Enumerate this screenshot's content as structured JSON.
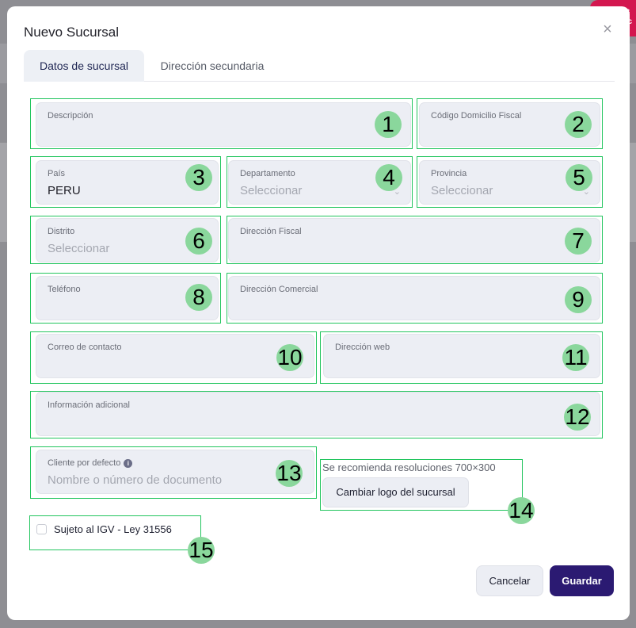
{
  "background": {
    "badge_text": "ic ac"
  },
  "modal": {
    "title": "Nuevo Sucursal",
    "close_symbol": "×"
  },
  "tabs": [
    {
      "label": "Datos de sucursal",
      "active": true
    },
    {
      "label": "Dirección secundaria",
      "active": false
    }
  ],
  "fields": {
    "descripcion": {
      "label": "Descripción",
      "value": ""
    },
    "codigo_domicilio": {
      "label": "Código Domicilio Fiscal",
      "value": ""
    },
    "pais": {
      "label": "País",
      "value": "PERU"
    },
    "departamento": {
      "label": "Departamento",
      "placeholder": "Seleccionar"
    },
    "provincia": {
      "label": "Provincia",
      "placeholder": "Seleccionar"
    },
    "distrito": {
      "label": "Distrito",
      "placeholder": "Seleccionar"
    },
    "direccion_fiscal": {
      "label": "Dirección Fiscal",
      "value": ""
    },
    "telefono": {
      "label": "Teléfono",
      "value": ""
    },
    "direccion_comercial": {
      "label": "Dirección Comercial",
      "value": ""
    },
    "correo": {
      "label": "Correo de contacto",
      "value": ""
    },
    "direccion_web": {
      "label": "Dirección web",
      "value": ""
    },
    "informacion_adicional": {
      "label": "Información adicional",
      "value": ""
    },
    "cliente_defecto": {
      "label": "Cliente por defecto",
      "placeholder": "Nombre o número de documento"
    }
  },
  "logo": {
    "hint": "Se recomienda resoluciones 700×300",
    "button_label": "Cambiar logo del sucursal"
  },
  "igv": {
    "label": "Sujeto al IGV - Ley 31556",
    "checked": false
  },
  "footer": {
    "cancel_label": "Cancelar",
    "save_label": "Guardar"
  },
  "annotations": [
    "1",
    "2",
    "3",
    "4",
    "5",
    "6",
    "7",
    "8",
    "9",
    "10",
    "11",
    "12",
    "13",
    "14",
    "15"
  ]
}
